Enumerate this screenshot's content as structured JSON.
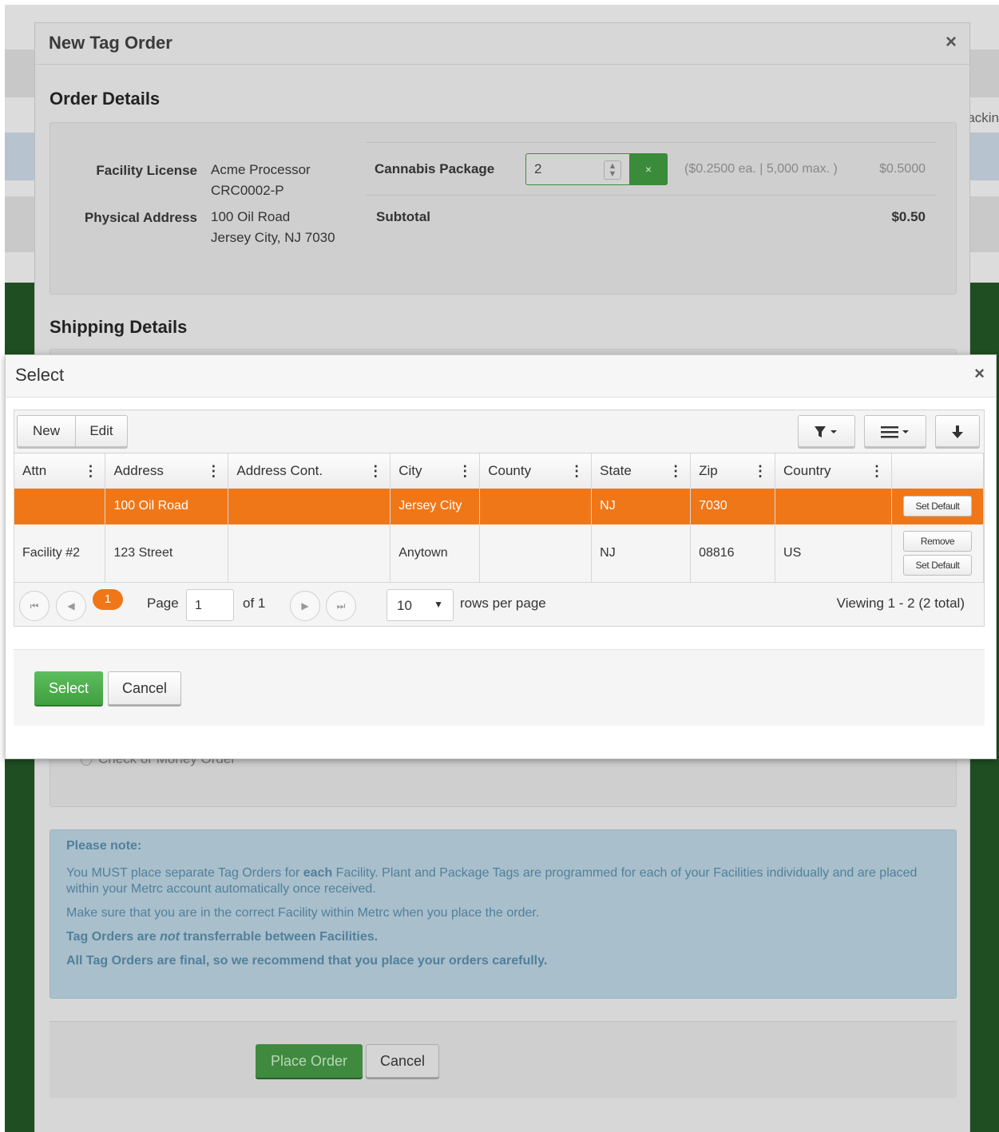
{
  "background": {
    "tracking_partial": "ackin",
    "order_modal": {
      "title": "New Tag Order",
      "close": "×",
      "order_details": {
        "heading": "Order Details",
        "facility_license_label": "Facility License",
        "facility_license_line1": "Acme Processor",
        "facility_license_line2": "CRC0002-P",
        "physical_address_label": "Physical Address",
        "physical_address_line1": "100 Oil Road",
        "physical_address_line2": "Jersey City, NJ 7030",
        "cannabis_package_label": "Cannabis Package",
        "quantity_value": "2",
        "clear_icon": "×",
        "price_hint": "($0.2500 ea. | 5,000 max. )",
        "line_total": "$0.5000",
        "subtotal_label": "Subtotal",
        "subtotal_value": "$0.50"
      },
      "shipping_details": {
        "heading": "Shipping Details",
        "payment_option": "Check or Money Order"
      },
      "note": {
        "heading": "Please note:",
        "line1_pre": "You MUST place separate Tag Orders for ",
        "line1_bold": "each",
        "line1_post": " Facility. Plant and Package Tags are programmed for each of your Facilities individually and are placed within your Metrc account automatically once received.",
        "line2": "Make sure that you are in the correct Facility within Metrc when you place the order.",
        "line3_pre": "Tag Orders are ",
        "line3_em": "not",
        "line3_post": " transferrable between Facilities.",
        "line4": "All Tag Orders are final, so we recommend that you place your orders carefully."
      },
      "buttons": {
        "place_order": "Place Order",
        "cancel": "Cancel"
      }
    }
  },
  "select_modal": {
    "title": "Select",
    "close": "×",
    "toolbar": {
      "new": "New",
      "edit": "Edit"
    },
    "columns": [
      "Attn",
      "Address",
      "Address Cont.",
      "City",
      "County",
      "State",
      "Zip",
      "Country"
    ],
    "rows": [
      {
        "attn": "",
        "address": "100 Oil Road",
        "address_cont": "",
        "city": "Jersey City",
        "county": "",
        "state": "NJ",
        "zip": "7030",
        "country": "",
        "actions": [
          "Set Default"
        ]
      },
      {
        "attn": "Facility #2",
        "address": "123 Street",
        "address_cont": "",
        "city": "Anytown",
        "county": "",
        "state": "NJ",
        "zip": "08816",
        "country": "US",
        "actions": [
          "Remove",
          "Set Default"
        ]
      }
    ],
    "pager": {
      "current_page_badge": "1",
      "page_label": "Page",
      "page_value": "1",
      "of_label": "of 1",
      "rows_per_page_value": "10",
      "rows_per_page_label": "rows per page",
      "viewing": "Viewing 1 - 2 (2 total)"
    },
    "footer": {
      "select": "Select",
      "cancel": "Cancel"
    },
    "colors": {
      "accent_orange": "#f07718",
      "select_green": "#4cae4c"
    }
  }
}
